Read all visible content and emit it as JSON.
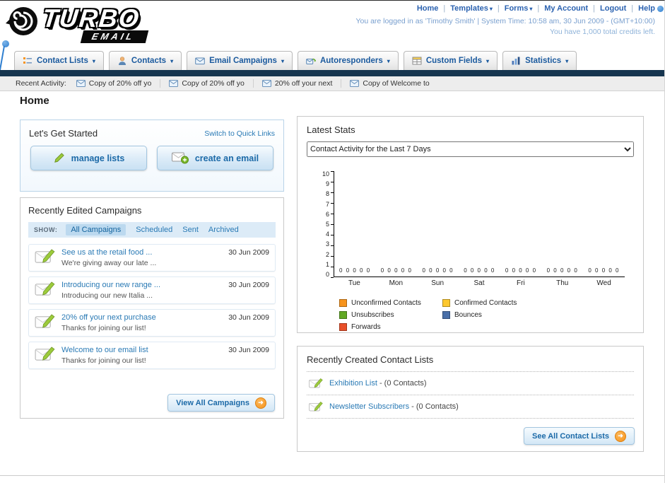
{
  "page": {
    "title": "Home"
  },
  "header": {
    "logo": {
      "word": "TURBO",
      "sub": "EMAIL"
    },
    "top_links": [
      {
        "label": "Home"
      },
      {
        "label": "Templates",
        "caret": true
      },
      {
        "label": "Forms",
        "caret": true
      },
      {
        "label": "My Account"
      },
      {
        "label": "Logout"
      },
      {
        "label": "Help"
      }
    ],
    "session_line": "You are logged in as 'Timothy Smith' | System Time: 10:58 am, 30 Jun 2009 - (GMT+10:00)",
    "credits_line": "You have 1,000 total credits left."
  },
  "nav": {
    "tabs": [
      {
        "label": "Contact Lists"
      },
      {
        "label": "Contacts"
      },
      {
        "label": "Email Campaigns"
      },
      {
        "label": "Autoresponders"
      },
      {
        "label": "Custom Fields"
      },
      {
        "label": "Statistics"
      }
    ]
  },
  "recent_activity": {
    "label": "Recent Activity:",
    "items": [
      {
        "text": "Copy of 20% off yo"
      },
      {
        "text": "Copy of 20% off yo"
      },
      {
        "text": "20% off your next"
      },
      {
        "text": "Copy of Welcome to"
      }
    ]
  },
  "get_started": {
    "title": "Let's Get Started",
    "switch_link": "Switch to Quick Links",
    "manage_lists_label": "manage lists",
    "create_email_label": "create an email"
  },
  "campaigns": {
    "title": "Recently Edited Campaigns",
    "show_label": "SHOW:",
    "filters": [
      {
        "label": "All Campaigns",
        "active": true
      },
      {
        "label": "Scheduled"
      },
      {
        "label": "Sent"
      },
      {
        "label": "Archived"
      }
    ],
    "rows": [
      {
        "title": "See us at the retail food ...",
        "subtitle": "We're giving away our late ...",
        "date": "30 Jun 2009"
      },
      {
        "title": "Introducing our new range ...",
        "subtitle": "Introducing our new Italia ...",
        "date": "30 Jun 2009"
      },
      {
        "title": "20% off your next purchase",
        "subtitle": "Thanks for joining our list!",
        "date": "30 Jun 2009"
      },
      {
        "title": "Welcome to our email list",
        "subtitle": "Thanks for joining our list!",
        "date": "30 Jun 2009"
      }
    ],
    "view_all_label": "View All Campaigns"
  },
  "stats": {
    "title": "Latest Stats",
    "selected_option": "Contact Activity for the Last 7 Days"
  },
  "chart_data": {
    "type": "bar",
    "title": "Contact Activity for the Last 7 Days",
    "categories": [
      "Tue",
      "Mon",
      "Sun",
      "Sat",
      "Fri",
      "Thu",
      "Wed"
    ],
    "series": [
      {
        "name": "Unconfirmed Contacts",
        "color": "#f7941d",
        "values": [
          0,
          0,
          0,
          0,
          0,
          0,
          0
        ]
      },
      {
        "name": "Confirmed Contacts",
        "color": "#fdc82f",
        "values": [
          0,
          0,
          0,
          0,
          0,
          0,
          0
        ]
      },
      {
        "name": "Unsubscribes",
        "color": "#61a824",
        "values": [
          0,
          0,
          0,
          0,
          0,
          0,
          0
        ]
      },
      {
        "name": "Bounces",
        "color": "#4a6fa8",
        "values": [
          0,
          0,
          0,
          0,
          0,
          0,
          0
        ]
      },
      {
        "name": "Forwards",
        "color": "#e8502a",
        "values": [
          0,
          0,
          0,
          0,
          0,
          0,
          0
        ]
      }
    ],
    "ylim": [
      0,
      10
    ],
    "yticks": [
      "10",
      "9",
      "8",
      "7",
      "6",
      "5",
      "4",
      "3",
      "2",
      "1",
      "0"
    ],
    "value_labels": "0 0 0 0 0",
    "legend_position": "bottom",
    "grid": false
  },
  "contact_lists": {
    "title": "Recently Created Contact Lists",
    "items": [
      {
        "name": "Exhibition List",
        "suffix": "- (0 Contacts)"
      },
      {
        "name": "Newsletter Subscribers",
        "suffix": "- (0 Contacts)"
      }
    ],
    "see_all_label": "See All Contact Lists"
  }
}
